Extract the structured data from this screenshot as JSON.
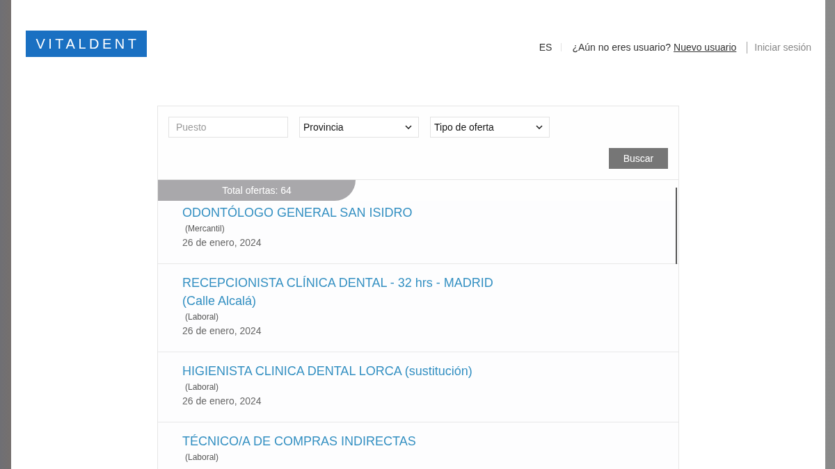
{
  "logo": {
    "text": "VITALDENT"
  },
  "header": {
    "language": "ES",
    "prompt": "¿Aún no eres usuario?",
    "register_link": "Nuevo usuario",
    "login_link": "Iniciar sesión"
  },
  "search": {
    "fields": [
      {
        "kind": "text",
        "placeholder": "Puesto"
      },
      {
        "kind": "select",
        "value": "Provincia"
      },
      {
        "kind": "select",
        "value": "Tipo de oferta"
      }
    ],
    "button": "Buscar"
  },
  "results": {
    "total": "Total ofertas: 64",
    "offers": [
      {
        "title": "ODONTÓLOGO GENERAL SAN ISIDRO",
        "contract": "(Mercantil)",
        "date": "26 de enero, 2024"
      },
      {
        "title": "RECEPCIONISTA CLÍNICA DENTAL - 32 hrs - MADRID (Calle Alcalá)",
        "contract": "(Laboral)",
        "date": "26 de enero, 2024"
      },
      {
        "title": "HIGIENISTA CLINICA DENTAL LORCA (sustitución)",
        "contract": "(Laboral)",
        "date": "26 de enero, 2024"
      },
      {
        "title": "TÉCNICO/A DE COMPRAS INDIRECTAS",
        "contract": "(Laboral)"
      }
    ]
  }
}
